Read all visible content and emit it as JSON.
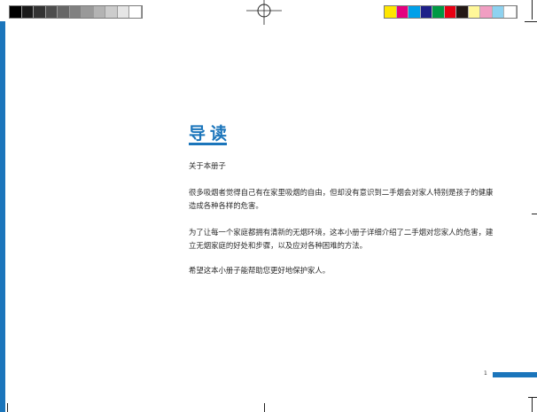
{
  "title": "导读",
  "subtitle": "关于本册子",
  "paragraphs": [
    "很多吸烟者觉得自己有在家里吸烟的自由，但却没有意识到二手烟会对家人特别是孩子的健康造成各种各样的危害。",
    "为了让每一个家庭都拥有清新的无烟环境，这本小册子详细介绍了二手烟对您家人的危害，建立无烟家庭的好处和步骤，以及应对各种困难的方法。",
    "希望这本小册子能帮助您更好地保护家人。"
  ],
  "page_number": "1",
  "colors": {
    "accent": "#1b75bb",
    "gray_ramp": [
      "#000000",
      "#1a1a1a",
      "#333333",
      "#4d4d4d",
      "#666666",
      "#808080",
      "#999999",
      "#b3b3b3",
      "#cccccc",
      "#e6e6e6",
      "#ffffff"
    ],
    "color_bar": [
      "#ffe600",
      "#e4007f",
      "#00a0e9",
      "#1d2088",
      "#009944",
      "#e60012",
      "#231815",
      "#fff799",
      "#f19ec2",
      "#8ed2f0",
      "#ffffff"
    ]
  }
}
